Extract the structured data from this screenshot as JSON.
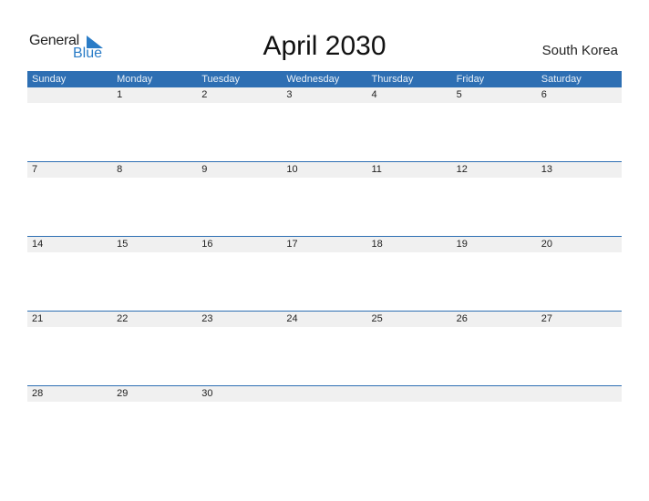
{
  "logo": {
    "word1": "General",
    "word2": "Blue"
  },
  "header": {
    "title": "April 2030",
    "country": "South Korea"
  },
  "colors": {
    "accent": "#2e6fb3",
    "strip": "#f0f0f0",
    "logo_blue": "#2a7cc7"
  },
  "weekdays": [
    "Sunday",
    "Monday",
    "Tuesday",
    "Wednesday",
    "Thursday",
    "Friday",
    "Saturday"
  ],
  "weeks": [
    [
      "",
      "1",
      "2",
      "3",
      "4",
      "5",
      "6"
    ],
    [
      "7",
      "8",
      "9",
      "10",
      "11",
      "12",
      "13"
    ],
    [
      "14",
      "15",
      "16",
      "17",
      "18",
      "19",
      "20"
    ],
    [
      "21",
      "22",
      "23",
      "24",
      "25",
      "26",
      "27"
    ],
    [
      "28",
      "29",
      "30",
      "",
      "",
      "",
      ""
    ]
  ]
}
